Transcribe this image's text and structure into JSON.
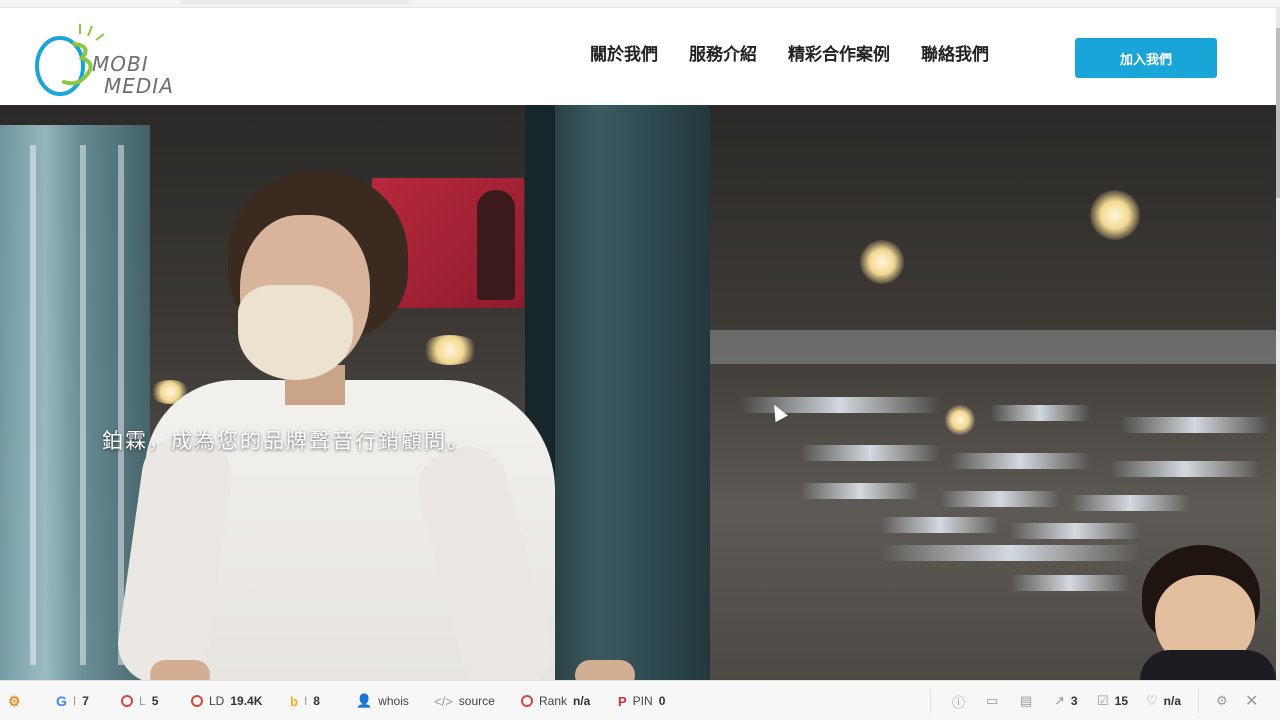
{
  "header": {
    "logo": {
      "line1": "MOBI",
      "line2": "MEDIA"
    },
    "nav": [
      {
        "label": "關於我們"
      },
      {
        "label": "服務介紹"
      },
      {
        "label": "精彩合作案例"
      },
      {
        "label": "聯絡我們"
      }
    ],
    "join_label": "加入我們",
    "accent": "#1aa5d9"
  },
  "hero": {
    "tagline": "鉑霖，成為您的品牌聲音行銷顧問。"
  },
  "toolbar": {
    "google_index": "7",
    "links": "5",
    "ld_label": "LD",
    "ld_value": "19.4K",
    "bing_index": "8",
    "whois": "whois",
    "source": "source",
    "rank_label": "Rank",
    "rank_value": "n/a",
    "pin_label": "PIN",
    "pin_value": "0",
    "external_links": "3",
    "internal_links": "15",
    "density_value": "n/a",
    "icons": [
      "seoquake-icon",
      "google-icon",
      "link-icon",
      "ld-icon",
      "bing-icon",
      "whois-icon",
      "source-icon",
      "rank-icon",
      "pinterest-icon",
      "info-icon",
      "display-icon",
      "page-icon",
      "external-link-icon",
      "internal-link-icon",
      "density-icon",
      "settings-icon",
      "close-icon"
    ]
  }
}
